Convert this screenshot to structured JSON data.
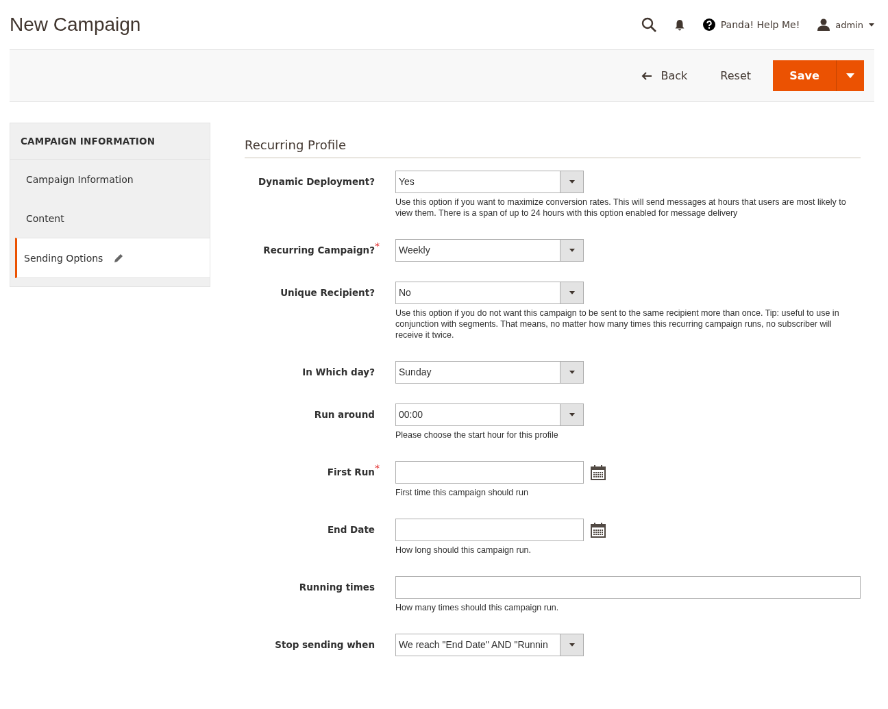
{
  "page_title": "New Campaign",
  "header": {
    "help": "Panda! Help Me!",
    "user": "admin"
  },
  "toolbar": {
    "back": "Back",
    "reset": "Reset",
    "save": "Save"
  },
  "sidebar": {
    "title": "CAMPAIGN INFORMATION",
    "items": [
      {
        "label": "Campaign Information",
        "selected": false,
        "edited": false
      },
      {
        "label": "Content",
        "selected": false,
        "edited": false
      },
      {
        "label": "Sending Options",
        "selected": true,
        "edited": true
      }
    ]
  },
  "section_title": "Recurring Profile",
  "required_mark": "*",
  "fields": [
    {
      "kind": "select",
      "label": "Dynamic Deployment?",
      "required": false,
      "value": "Yes",
      "note": "Use this option if you want to maximize conversion rates. This will send messages at hours that users are most likely to view them. There is a span of up to 24 hours with this option enabled for message delivery"
    },
    {
      "kind": "select",
      "label": "Recurring Campaign?",
      "required": true,
      "value": "Weekly"
    },
    {
      "kind": "select",
      "label": "Unique Recipient?",
      "required": false,
      "value": "No",
      "note": "Use this option if you do not want this campaign to be sent to the same recipient more than once. Tip: useful to use in conjunction with segments. That means, no matter how many times this recurring campaign runs, no subscriber will receive it twice."
    },
    {
      "kind": "select",
      "label": "In Which day?",
      "required": false,
      "value": "Sunday"
    },
    {
      "kind": "select",
      "label": "Run around",
      "required": false,
      "value": "00:00",
      "note": "Please choose the start hour for this profile"
    },
    {
      "kind": "date",
      "label": "First Run",
      "required": true,
      "note": "First time this campaign should run"
    },
    {
      "kind": "date",
      "label": "End Date",
      "required": false,
      "note": "How long should this campaign run."
    },
    {
      "kind": "text",
      "label": "Running times",
      "required": false,
      "note": "How many times should this campaign run."
    },
    {
      "kind": "select",
      "label": "Stop sending when",
      "required": false,
      "value": "We reach \"End Date\" AND \"Runnin"
    }
  ]
}
